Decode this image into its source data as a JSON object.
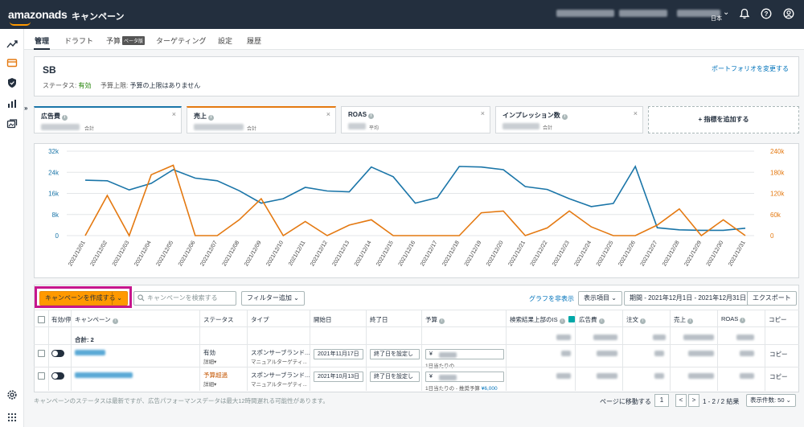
{
  "header": {
    "logo": "amazonads",
    "title": "キャンペーン",
    "lang": "日本"
  },
  "tabs": [
    "管理",
    "ドラフト",
    "予算",
    "ターゲティング",
    "設定",
    "履歴"
  ],
  "tab_badge": "ベータ版",
  "campaign": {
    "name": "SB",
    "status_label": "ステータス:",
    "status_value": "有効",
    "budget_label": "予算上限:",
    "budget_value": "予算の上限はありません",
    "portfolio_link": "ポートフォリオを変更する"
  },
  "metrics": [
    {
      "title": "広告費",
      "sub": "合計",
      "color": "#1a75a8"
    },
    {
      "title": "売上",
      "sub": "合計",
      "color": "#e47911"
    },
    {
      "title": "ROAS",
      "sub": "平均",
      "color": "#d5d9dc"
    },
    {
      "title": "インプレッション数",
      "sub": "合計",
      "color": "#d5d9dc"
    }
  ],
  "add_metric": "+ 指標を追加する",
  "chart_data": {
    "type": "line",
    "x": [
      "2021/12/01",
      "2021/12/02",
      "2021/12/03",
      "2021/12/04",
      "2021/12/05",
      "2021/12/06",
      "2021/12/07",
      "2021/12/08",
      "2021/12/09",
      "2021/12/10",
      "2021/12/11",
      "2021/12/12",
      "2021/12/13",
      "2021/12/14",
      "2021/12/15",
      "2021/12/16",
      "2021/12/17",
      "2021/12/18",
      "2021/12/19",
      "2021/12/20",
      "2021/12/21",
      "2021/12/22",
      "2021/12/23",
      "2021/12/24",
      "2021/12/25",
      "2021/12/26",
      "2021/12/27",
      "2021/12/28",
      "2021/12/29",
      "2021/12/30",
      "2021/12/31"
    ],
    "y_left": {
      "ticks": [
        "0",
        "8k",
        "16k",
        "24k",
        "32k"
      ],
      "range": [
        0,
        32000
      ]
    },
    "y_right": {
      "ticks": [
        "0",
        "60k",
        "120k",
        "180k",
        "240k"
      ],
      "range": [
        0,
        240000
      ]
    },
    "series": [
      {
        "color": "#1a75a8",
        "axis": "left",
        "values": [
          21000,
          20800,
          17300,
          19800,
          25000,
          21800,
          20800,
          17000,
          12300,
          14000,
          18300,
          16900,
          16600,
          26000,
          22300,
          12300,
          14400,
          26200,
          26000,
          25000,
          18600,
          17500,
          14000,
          11000,
          12200,
          26200,
          3000,
          2200,
          2000,
          2000,
          2800
        ]
      },
      {
        "color": "#e47911",
        "axis": "right",
        "values": [
          0,
          114000,
          0,
          173000,
          200000,
          0,
          0,
          45000,
          105000,
          0,
          40000,
          0,
          30000,
          45000,
          0,
          0,
          0,
          0,
          65000,
          70000,
          0,
          22000,
          70000,
          25000,
          0,
          0,
          30000,
          76000,
          0,
          45000,
          0
        ]
      }
    ],
    "grid": true
  },
  "toolbar": {
    "create": "キャンペーンを作成する",
    "search_placeholder": "キャンペーンを検索する",
    "filter": "フィルター追加",
    "hide_graph": "グラフを非表示",
    "display_items": "表示項目",
    "period": "期間 - 2021年12月1日 - 2021年12月31日",
    "export": "エクスポート"
  },
  "table": {
    "headers": [
      "有効/停",
      "キャンペーン",
      "ステータス",
      "タイプ",
      "開始日",
      "終了日",
      "予算",
      "検索結果上部のIS",
      "広告費",
      "注文",
      "売上",
      "ROAS",
      "コピー"
    ],
    "total_label": "合計: 2",
    "rows": [
      {
        "status": "有効",
        "status_sub": "詳細",
        "type": "スポンサーブランド...",
        "type_sub": "マニュアルターゲティ...",
        "start": "2021年11月17日",
        "end": "終了日を設定し",
        "budget_prefix": "¥",
        "budget_sub": "1日当たりの",
        "budget_sub2": "",
        "copy": "コピー"
      },
      {
        "status": "予算超過",
        "status_sub": "詳細",
        "type": "スポンサーブランド...",
        "type_sub": "マニュアルターゲティ...",
        "start": "2021年10月13日",
        "end": "終了日を設定し",
        "budget_prefix": "¥",
        "budget_sub": "1日当たりの - 推奨予算",
        "budget_sub2": "¥6,000",
        "copy": "コピー"
      }
    ]
  },
  "footer": {
    "note": "キャンペーンのステータスは最新ですが、広告パフォーマンスデータは最大12時間遅れる可能性があります。",
    "goto_page": "ページに移動する",
    "page": "1",
    "prev": "<",
    "next": ">",
    "results": "1 - 2 / 2 結果",
    "per_page": "表示件数: 50"
  }
}
